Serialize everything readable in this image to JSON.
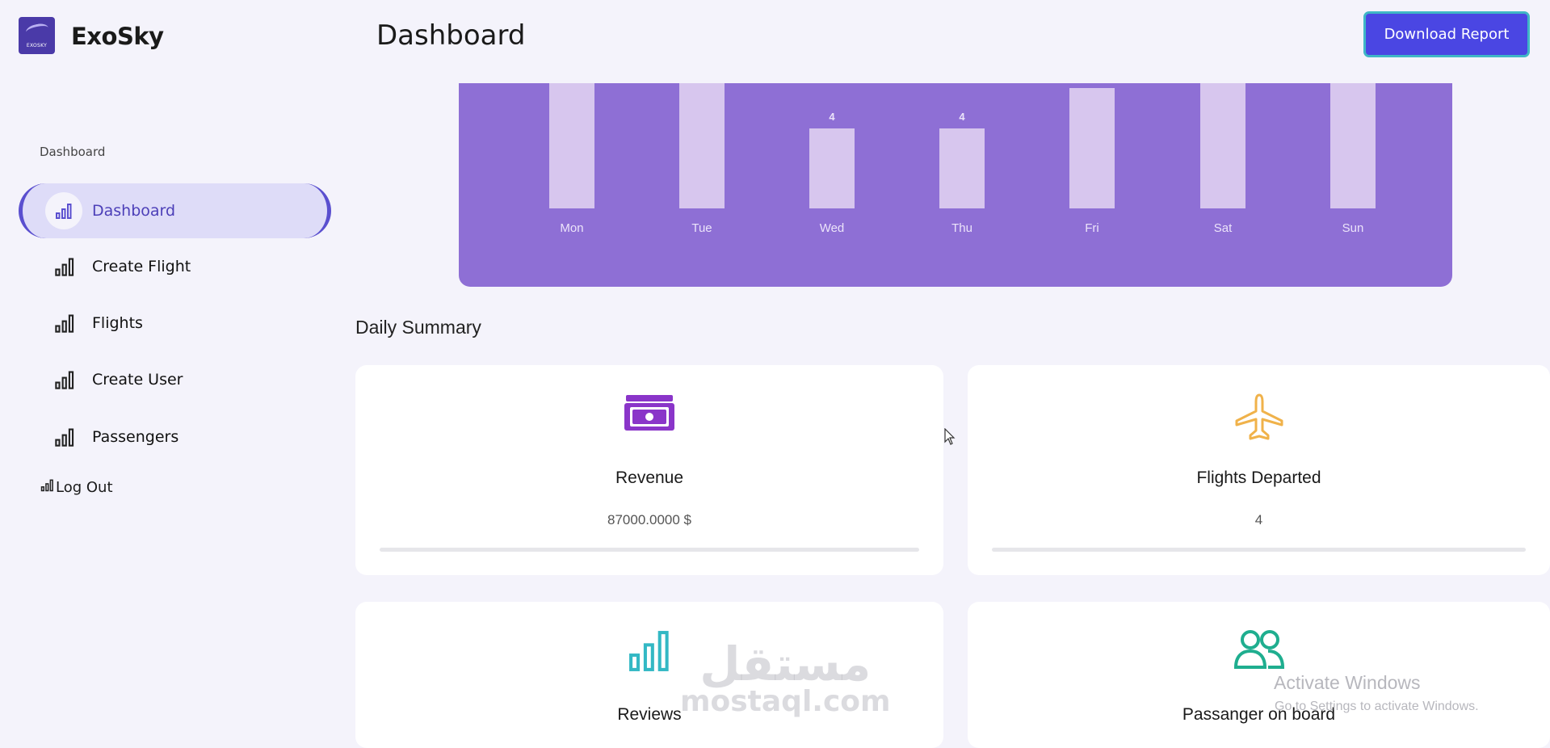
{
  "app": {
    "brand": "ExoSky",
    "logo_text": "EXOSKY",
    "page_title": "Dashboard",
    "download_button": "Download Report"
  },
  "sidebar": {
    "section_label": "Dashboard",
    "items": [
      {
        "label": "Dashboard",
        "icon": "bar-chart-icon",
        "active": true
      },
      {
        "label": "Create Flight",
        "icon": "bar-chart-icon"
      },
      {
        "label": "Flights",
        "icon": "bar-chart-icon"
      },
      {
        "label": "Create User",
        "icon": "bar-chart-icon"
      },
      {
        "label": "Passengers",
        "icon": "bar-chart-icon"
      }
    ],
    "logout": "Log Out"
  },
  "chart_data": {
    "type": "bar",
    "categories": [
      "Mon",
      "Tue",
      "Wed",
      "Thu",
      "Fri",
      "Sat",
      "Sun"
    ],
    "values": [
      null,
      null,
      4,
      4,
      null,
      null,
      null
    ],
    "value_labels": [
      "",
      "",
      "4",
      "4",
      "",
      "",
      ""
    ],
    "note_colors": {
      "panel": "#8e6fd5",
      "bar": "#d7c6ee"
    }
  },
  "summary": {
    "title": "Daily Summary",
    "cards": [
      {
        "title": "Revenue",
        "value": "87000.0000 $",
        "icon": "money-icon",
        "color": "#8a35c9"
      },
      {
        "title": "Flights Departed",
        "value": "4",
        "icon": "airplane-icon",
        "color": "#f0b24a"
      },
      {
        "title": "Reviews",
        "value": "",
        "icon": "bar-chart-icon",
        "color": "#33b8c4"
      },
      {
        "title": "Passanger on board",
        "value": "",
        "icon": "users-icon",
        "color": "#1fae8f"
      }
    ]
  },
  "overlay": {
    "activate_title": "Activate Windows",
    "activate_sub": "Go to Settings to activate Windows.",
    "watermark_ar": "مستقل",
    "watermark_en": "mostaql.com"
  }
}
